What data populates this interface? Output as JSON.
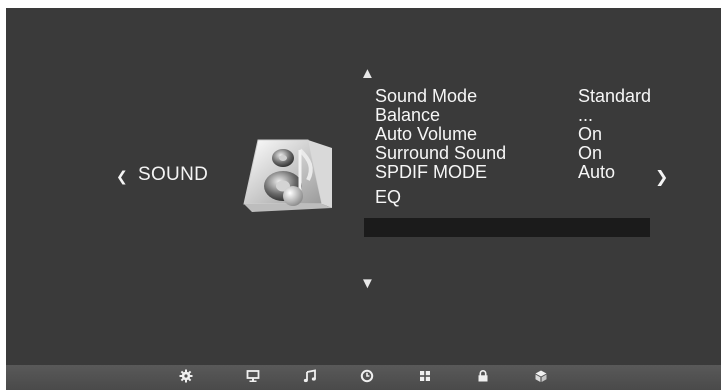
{
  "nav": {
    "prev_arrow": "❮",
    "next_arrow": "❯",
    "scroll_up": "▲",
    "scroll_down": "▼"
  },
  "section": {
    "title": "SOUND",
    "icon": "speaker-music-icon"
  },
  "menu": {
    "items": [
      {
        "label": "Sound Mode",
        "value": "Standard"
      },
      {
        "label": "Balance",
        "value": "..."
      },
      {
        "label": "Auto Volume",
        "value": "On"
      },
      {
        "label": "Surround Sound",
        "value": "On"
      },
      {
        "label": "SPDIF MODE",
        "value": "Auto"
      },
      {
        "label": "EQ",
        "value": ""
      }
    ]
  },
  "bottom_tabs": [
    {
      "icon": "gear-icon"
    },
    {
      "icon": "monitor-icon"
    },
    {
      "icon": "music-note-icon"
    },
    {
      "icon": "clock-icon"
    },
    {
      "icon": "grid-icon"
    },
    {
      "icon": "lock-icon"
    },
    {
      "icon": "cube-icon"
    }
  ],
  "colors": {
    "panel_bg": "#3a3a3a",
    "text": "#f6f6f6",
    "selection_bar": "#1b1b1b"
  }
}
